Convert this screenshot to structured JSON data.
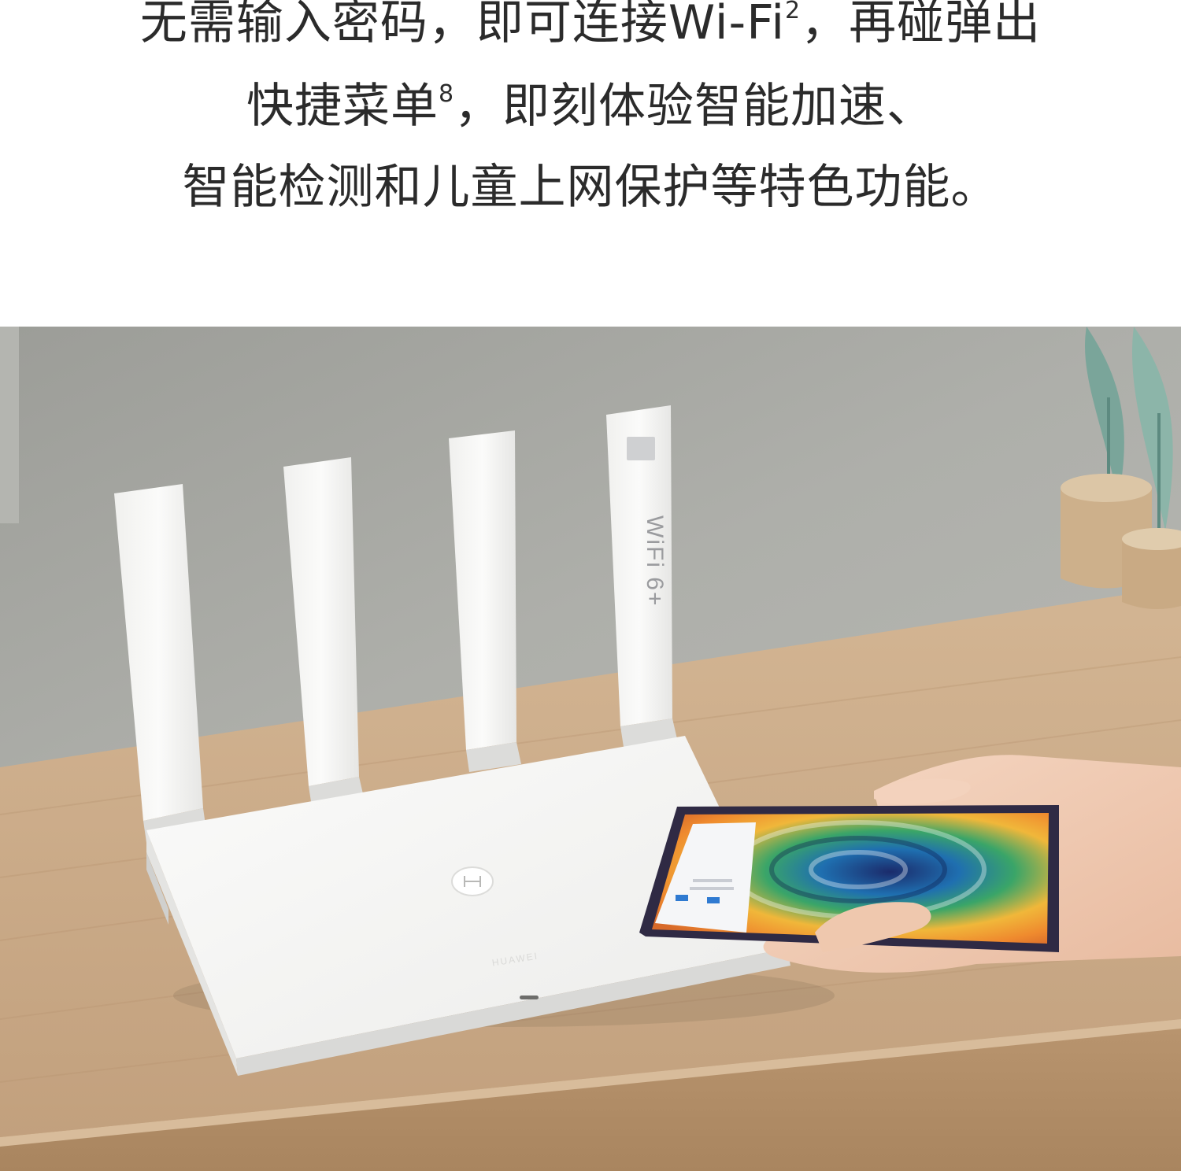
{
  "copy": {
    "line1_a": "无需输入密码，即可连接Wi-Fi",
    "line1_sup": "2",
    "line1_b": "，再碰弹出",
    "line2_a": "快捷菜单",
    "line2_sup": "8",
    "line2_b": "，即刻体验智能加速、",
    "line3": "智能检测和儿童上网保护等特色功能。"
  },
  "scene": {
    "antenna_badge": "WiFi 6+",
    "router_brand": "HUAWEI",
    "icons": [
      "nfc-tag-icon",
      "reset-port-icon"
    ],
    "colors": {
      "wall": "#a9aaa5",
      "desk": "#c9a987",
      "router": "#f4f4f2",
      "phone_frame": "#3a3450"
    }
  }
}
